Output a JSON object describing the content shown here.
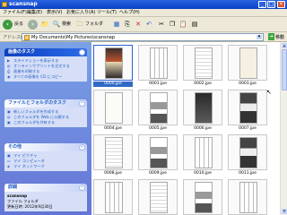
{
  "window": {
    "title": "scansnap",
    "buttons": {
      "minimize": "_",
      "maximize": "□",
      "close": "×"
    }
  },
  "menu": [
    "ファイル(F)",
    "編集(E)",
    "表示(V)",
    "お気に入り(A)",
    "ツール(T)",
    "ヘルプ(H)"
  ],
  "toolbar": {
    "back_label": "戻る",
    "search_label": "検索",
    "folders_label": "フォルダ"
  },
  "address": {
    "label": "アドレス(D)",
    "path": "My Documents\\My Pictures\\scansnap",
    "go_label": "移動"
  },
  "sidebar": {
    "image_tasks": {
      "title": "画像のタスク",
      "items": [
        "スライドショーを表示する",
        "オンラインでプリントを注文する",
        "画像を印刷する",
        "すべての画像を CD にコピー"
      ]
    },
    "file_tasks": {
      "title": "ファイルとフォルダのタスク",
      "items": [
        "新しいフォルダを作成する",
        "このフォルダを Web に公開する",
        "このフォルダを共有する"
      ]
    },
    "other_places": {
      "title": "その他",
      "items": [
        "マイ ピクチャ",
        "マイ コンピュータ",
        "マイ ネットワーク"
      ]
    },
    "details": {
      "title": "詳細",
      "name": "scansnap",
      "type": "ファイル フォルダ",
      "date": "更新日時: 2012年9月30日"
    }
  },
  "files": [
    {
      "name": "0000.jpe",
      "style": "p-cover",
      "selected": true
    },
    {
      "name": "0001.jpe",
      "style": "p-comic",
      "selected": false
    },
    {
      "name": "0002.jpe",
      "style": "p-light",
      "selected": false
    },
    {
      "name": "0003.jpe",
      "style": "p-cream",
      "selected": false
    },
    {
      "name": "0004.jpe",
      "style": "p-blank",
      "selected": false
    },
    {
      "name": "0005.jpe",
      "style": "p-mix",
      "selected": false
    },
    {
      "name": "0006.jpe",
      "style": "p-dark",
      "selected": false
    },
    {
      "name": "0007.jpe",
      "style": "p-mixdark",
      "selected": false
    },
    {
      "name": "0008.jpe",
      "style": "p-light",
      "selected": false
    },
    {
      "name": "0009.jpe",
      "style": "p-mix",
      "selected": false
    },
    {
      "name": "0010.jpe",
      "style": "p-comic",
      "selected": false
    },
    {
      "name": "0011.jpe",
      "style": "p-mixdark",
      "selected": false
    },
    {
      "name": "",
      "style": "p-comic",
      "selected": false
    },
    {
      "name": "",
      "style": "p-light",
      "selected": false
    },
    {
      "name": "",
      "style": "p-mix",
      "selected": false
    },
    {
      "name": "",
      "style": "p-comic",
      "selected": false
    }
  ]
}
